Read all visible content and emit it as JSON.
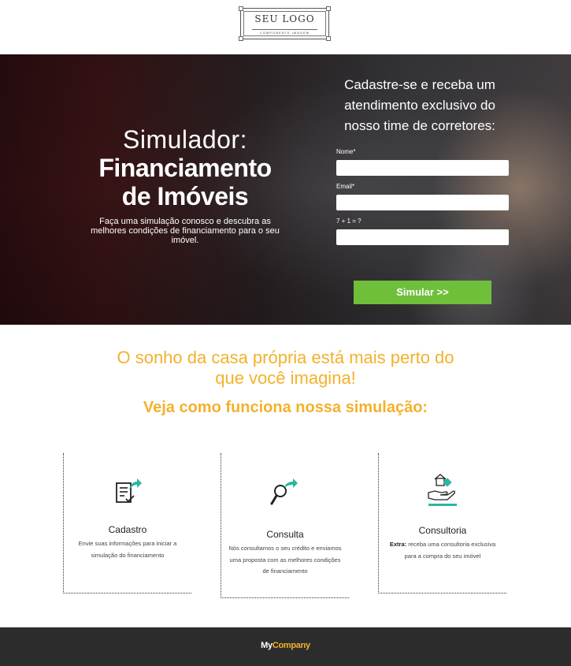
{
  "logo": {
    "text": "SEU LOGO",
    "subtext": "COMPONENTE IMAGEM"
  },
  "hero": {
    "title_line1": "Simulador:",
    "title_line2": "Financiamento",
    "title_line3": "de Imóveis",
    "description": "Faça uma simulação conosco e descubra as melhores condições de financiamento para o seu imóvel."
  },
  "form": {
    "title": "Cadastre-se e receba um atendimento exclusivo do nosso time de corretores:",
    "name_label": "Nome*",
    "email_label": "Email*",
    "captcha_label": "7 + 1 = ?",
    "name_value": "",
    "email_value": "",
    "captcha_value": "",
    "submit_label": "Simular >>"
  },
  "headline": {
    "main": "O sonho da casa própria está mais perto do que você imagina!",
    "sub": "Veja como funciona nossa simulação:"
  },
  "steps": [
    {
      "icon": "checklist-icon",
      "title": "Cadastro",
      "text": "Envie suas informações para iniciar a simulação do financiamento"
    },
    {
      "icon": "magnifier-icon",
      "title": "Consulta",
      "text": "Nós consultamos o seu crédito e enviamos uma proposta com as melhores condições de financiamento"
    },
    {
      "icon": "hand-house-icon",
      "title": "Consultoria",
      "text_bold": "Extra:",
      "text": " receba uma consultoria exclusiva para a compra do seu imóvel"
    }
  ],
  "footer": {
    "brand_part1": "My",
    "brand_part2": "Company"
  },
  "colors": {
    "accent": "#f3b12c",
    "button": "#6fbf3a",
    "teal": "#2bb6a3",
    "footer_bg": "#2c2c2c"
  }
}
